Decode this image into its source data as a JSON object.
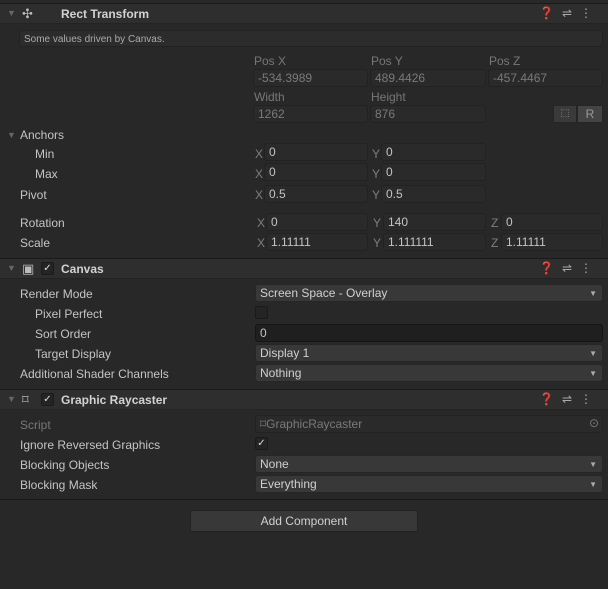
{
  "rect_transform": {
    "title": "Rect Transform",
    "help": "Some values driven by Canvas.",
    "pos_x_label": "Pos X",
    "pos_y_label": "Pos Y",
    "pos_z_label": "Pos Z",
    "pos_x": "-534.3989",
    "pos_y": "489.4426",
    "pos_z": "-457.4467",
    "width_label": "Width",
    "height_label": "Height",
    "width": "1262",
    "height": "876",
    "raw_button": "R",
    "anchors_label": "Anchors",
    "min_label": "Min",
    "max_label": "Max",
    "min_x": "0",
    "min_y": "0",
    "max_x": "0",
    "max_y": "0",
    "pivot_label": "Pivot",
    "pivot_x": "0.5",
    "pivot_y": "0.5",
    "rotation_label": "Rotation",
    "rot_x": "0",
    "rot_y": "140",
    "rot_z": "0",
    "scale_label": "Scale",
    "scale_x": "1.11111",
    "scale_y": "1.111111",
    "scale_z": "1.11111",
    "x": "X",
    "y": "Y",
    "z": "Z"
  },
  "canvas": {
    "title": "Canvas",
    "enabled": true,
    "render_mode_label": "Render Mode",
    "render_mode": "Screen Space - Overlay",
    "pixel_perfect_label": "Pixel Perfect",
    "pixel_perfect": false,
    "sort_order_label": "Sort Order",
    "sort_order": "0",
    "target_display_label": "Target Display",
    "target_display": "Display 1",
    "shader_channels_label": "Additional Shader Channels",
    "shader_channels": "Nothing"
  },
  "raycaster": {
    "title": "Graphic Raycaster",
    "enabled": true,
    "script_label": "Script",
    "script": "GraphicRaycaster",
    "ignore_reversed_label": "Ignore Reversed Graphics",
    "ignore_reversed": true,
    "blocking_objects_label": "Blocking Objects",
    "blocking_objects": "None",
    "blocking_mask_label": "Blocking Mask",
    "blocking_mask": "Everything"
  },
  "add_component": "Add Component",
  "icons": {
    "help": "help-icon",
    "presets": "sliders-icon",
    "menu": "kebab-menu-icon"
  }
}
